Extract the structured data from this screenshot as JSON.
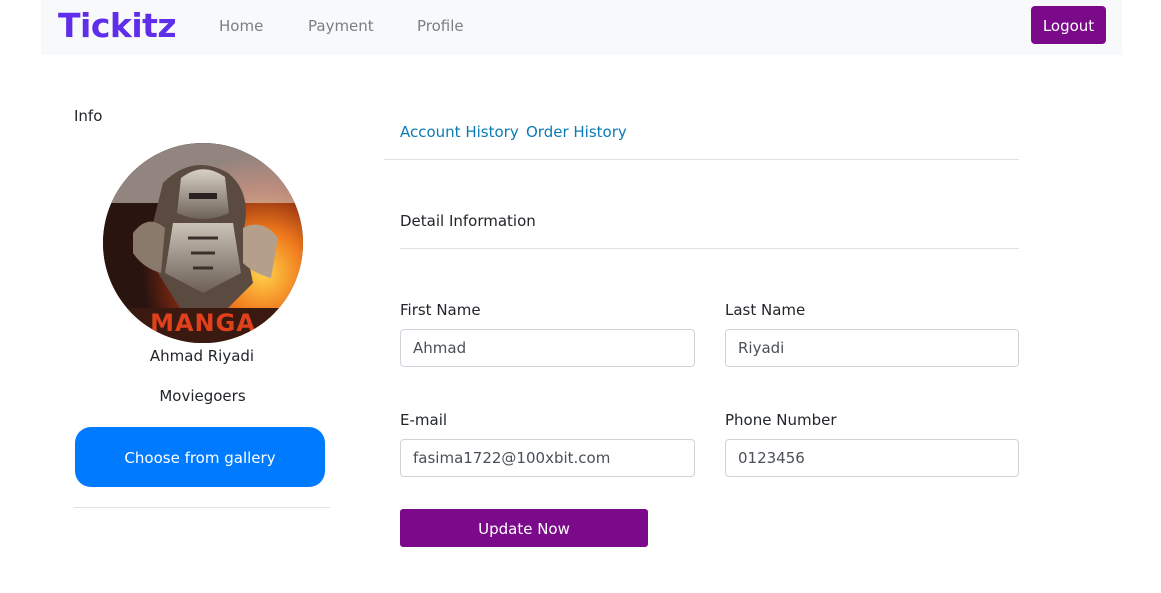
{
  "navbar": {
    "brand": "Tickitz",
    "brand_color": "#5f2eea",
    "links": {
      "home": "Home",
      "payment": "Payment",
      "profile": "Profile"
    },
    "logout_label": "Logout",
    "logout_color": "#7b0a8b"
  },
  "info_panel": {
    "title": "Info",
    "avatar_icon": "user-avatar-image",
    "name": "Ahmad Riyadi",
    "role": "Moviegoers",
    "gallery_button_label": "Choose from gallery",
    "gallery_button_color": "#007bff"
  },
  "tabs": {
    "account_history": "Account History",
    "order_history": "Order History"
  },
  "detail": {
    "title": "Detail Information",
    "first_name": {
      "label": "First Name",
      "value": "Ahmad"
    },
    "last_name": {
      "label": "Last Name",
      "value": "Riyadi"
    },
    "email": {
      "label": "E-mail",
      "value": "fasima1722@100xbit.com"
    },
    "phone": {
      "label": "Phone Number",
      "value": "0123456"
    },
    "update_button_label": "Update Now",
    "update_button_color": "#7b0a8b"
  }
}
